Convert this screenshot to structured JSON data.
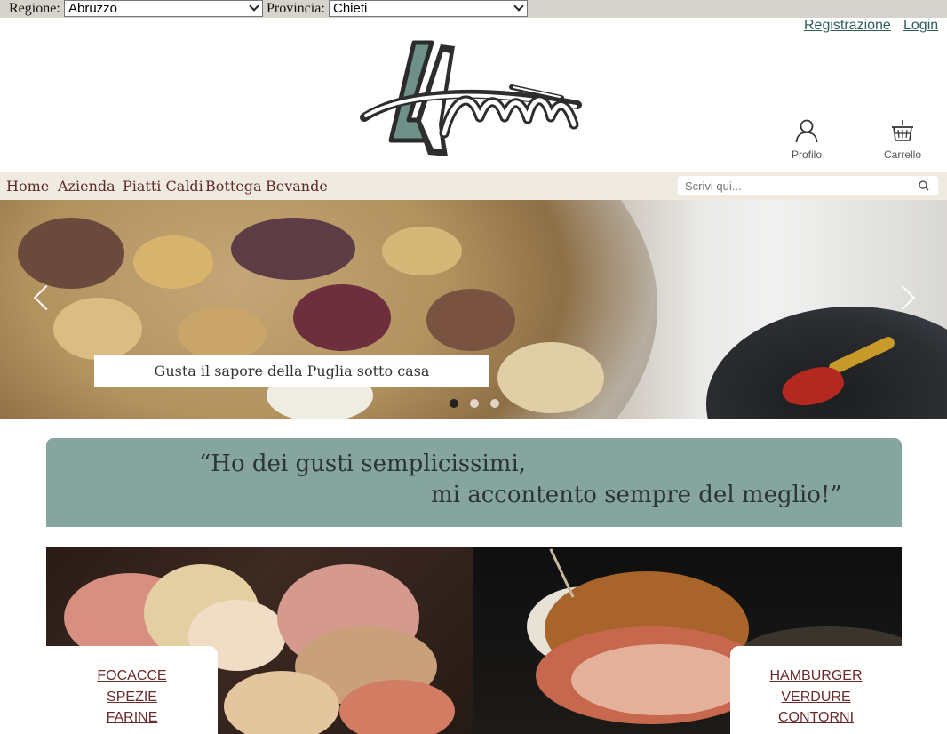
{
  "filters": {
    "region_label": "Regione:",
    "region_value": "Abruzzo",
    "province_label": "Provincia:",
    "province_value": "Chieti"
  },
  "account": {
    "register": "Registrazione",
    "login": "Login"
  },
  "header": {
    "profile_label": "Profilo",
    "cart_label": "Carrello"
  },
  "nav": {
    "items": [
      "Home",
      "Azienda",
      "Piatti Caldi",
      "Bottega",
      "Bevande"
    ]
  },
  "search": {
    "placeholder": "Scrivi qui..."
  },
  "hero": {
    "caption": "Gusta il sapore della Puglia sotto casa",
    "slides": 3,
    "active_slide": 1
  },
  "quote": {
    "line1": "“Ho dei gusti semplicissimi,",
    "line2": "mi accontento sempre del meglio!”"
  },
  "categories": {
    "left": [
      "FOCACCE",
      "SPEZIE",
      "FARINE"
    ],
    "right": [
      "HAMBURGER",
      "VERDURE",
      "CONTORNI"
    ]
  },
  "colors": {
    "accent_green": "#87a59f",
    "nav_bg": "#f0ebe0",
    "link_brown": "#6a2a2a"
  }
}
